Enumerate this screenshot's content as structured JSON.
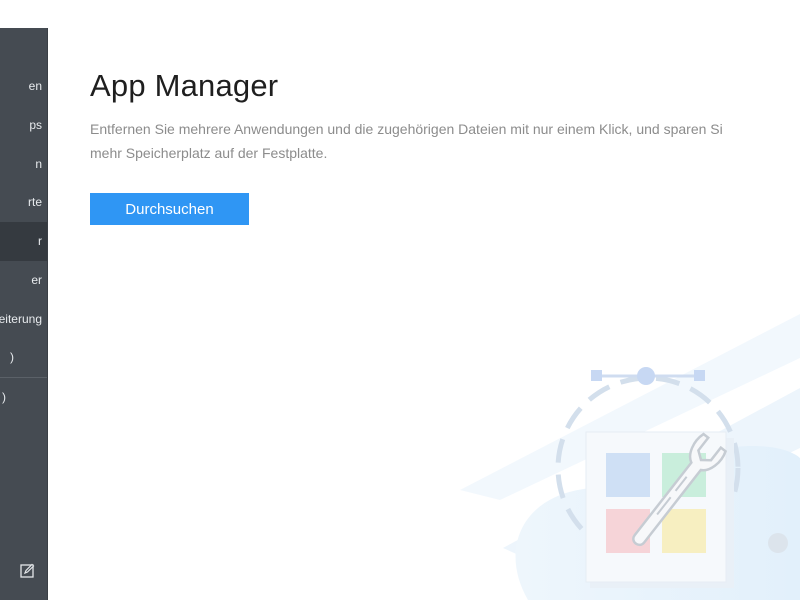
{
  "sidebar": {
    "items": [
      {
        "label": "en"
      },
      {
        "label": "ps"
      },
      {
        "label": "n"
      },
      {
        "label": "rte"
      },
      {
        "label": "r"
      },
      {
        "label": "er"
      },
      {
        "label": "eiterung"
      },
      {
        "label": ")"
      },
      {
        "label": ")"
      }
    ],
    "active_index": 4
  },
  "main": {
    "title": "App Manager",
    "description_line1": "Entfernen Sie mehrere Anwendungen und die zugehörigen Dateien mit nur einem Klick, und sparen Si",
    "description_line2": "mehr Speicherplatz auf der Festplatte.",
    "scan_button": "Durchsuchen"
  },
  "colors": {
    "sidebar_bg": "#454b52",
    "sidebar_active": "#353a40",
    "accent": "#2f96f4"
  },
  "icons": {
    "feedback": "edit-note-icon",
    "illustration": "app-tiles-with-wrench-illustration"
  }
}
